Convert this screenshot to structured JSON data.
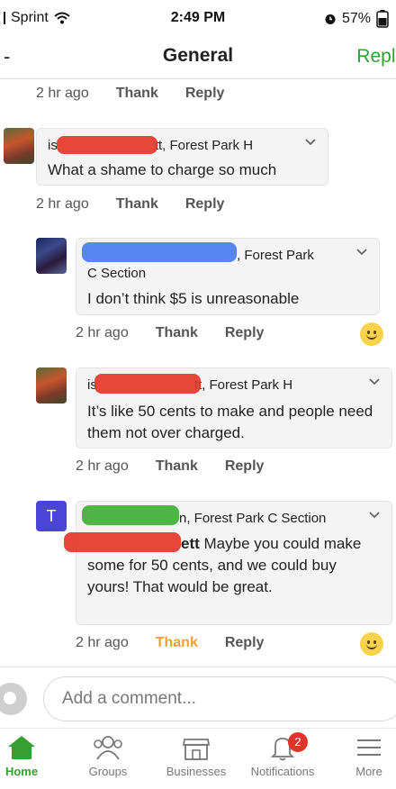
{
  "status_bar": {
    "carrier": "Sprint",
    "time": "2:49 PM",
    "battery": "57%"
  },
  "header": {
    "back": "-",
    "title": "General",
    "reply": "Reply"
  },
  "comments": [
    {
      "id": "c0",
      "time": "2 hr ago",
      "thank": "Thank",
      "reply": "Reply"
    },
    {
      "id": "c1",
      "author_visible": "tt, Forest Park H",
      "author_prefix": "is",
      "text": "What a shame to charge so much",
      "time": "2 hr ago",
      "thank": "Thank",
      "reply": "Reply"
    },
    {
      "id": "c2",
      "author_visible": ", Forest Park",
      "author_line2": "C Section",
      "text": "I don’t think $5 is unreasonable",
      "time": "2 hr ago",
      "thank": "Thank",
      "reply": "Reply"
    },
    {
      "id": "c3",
      "author_visible": "tt, Forest Park H",
      "author_prefix": "is",
      "text": "It’s like 50 cents to make and people need them not over charged.",
      "time": "2 hr ago",
      "thank": "Thank",
      "reply": "Reply"
    },
    {
      "id": "c4",
      "avatar_letter": "T",
      "author_visible": "n, Forest Park C Section",
      "mention_visible": "ett",
      "text": "Maybe you could make some for 50 cents, and we could buy yours!  That would be great.",
      "time": "2 hr ago",
      "thank": "Thank",
      "reply": "Reply"
    }
  ],
  "composer": {
    "placeholder": "Add a comment..."
  },
  "tabbar": {
    "home": "Home",
    "groups": "Groups",
    "businesses": "Businesses",
    "notifications": "Notifications",
    "notifications_badge": "2",
    "more": "More"
  },
  "colors": {
    "accent": "#35a031",
    "thank_active": "#f0a030",
    "badge": "#e0332b"
  }
}
